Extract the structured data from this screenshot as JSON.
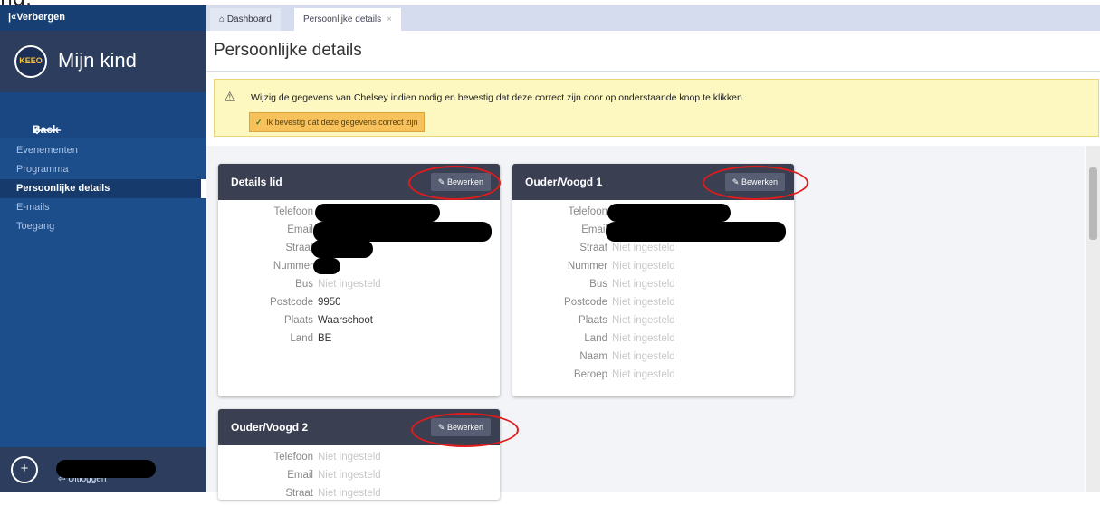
{
  "sidebar": {
    "hide_label": "|«Verbergen",
    "brand_title": "Mijn kind",
    "logo_text": "KEEO",
    "back_label": "Back",
    "nav_items": [
      {
        "label": "Evenementen",
        "active": false
      },
      {
        "label": "Programma",
        "active": false
      },
      {
        "label": "Persoonlijke details",
        "active": true
      },
      {
        "label": "E-mails",
        "active": false
      },
      {
        "label": "Toegang",
        "active": false
      }
    ],
    "logout_label": "Uitloggen"
  },
  "tabs": {
    "dashboard": "Dashboard",
    "personal": "Persoonlijke details"
  },
  "page_title": "Persoonlijke details",
  "warning": {
    "text": "Wijzig de gegevens van Chelsey indien nodig en bevestig dat deze correct zijn door op onderstaande knop te klikken.",
    "confirm_button": "Ik bevestig dat deze gegevens correct zijn"
  },
  "cards": {
    "details": {
      "title": "Details lid",
      "edit_label": "Bewerken",
      "fields": [
        {
          "label": "Telefoon",
          "value": ""
        },
        {
          "label": "Email",
          "value": ""
        },
        {
          "label": "Straat",
          "value": ""
        },
        {
          "label": "Nummer",
          "value": ""
        },
        {
          "label": "Bus",
          "value": "Niet ingesteld"
        },
        {
          "label": "Postcode",
          "value": "9950"
        },
        {
          "label": "Plaats",
          "value": "Waarschoot"
        },
        {
          "label": "Land",
          "value": "BE"
        }
      ]
    },
    "guardian1": {
      "title": "Ouder/Voogd 1",
      "edit_label": "Bewerken",
      "fields": [
        {
          "label": "Telefoon",
          "value": ""
        },
        {
          "label": "Email",
          "value": ""
        },
        {
          "label": "Straat",
          "value": "Niet ingesteld"
        },
        {
          "label": "Nummer",
          "value": "Niet ingesteld"
        },
        {
          "label": "Bus",
          "value": "Niet ingesteld"
        },
        {
          "label": "Postcode",
          "value": "Niet ingesteld"
        },
        {
          "label": "Plaats",
          "value": "Niet ingesteld"
        },
        {
          "label": "Land",
          "value": "Niet ingesteld"
        },
        {
          "label": "Naam",
          "value": "Niet ingesteld"
        },
        {
          "label": "Beroep",
          "value": "Niet ingesteld"
        }
      ]
    },
    "guardian2": {
      "title": "Ouder/Voogd 2",
      "edit_label": "Bewerken",
      "fields": [
        {
          "label": "Telefoon",
          "value": "Niet ingesteld"
        },
        {
          "label": "Email",
          "value": "Niet ingesteld"
        },
        {
          "label": "Straat",
          "value": "Niet ingesteld"
        }
      ]
    }
  },
  "colors": {
    "sidebar": "#1c4e8c",
    "card_header": "#3a3f52",
    "warning_bg": "#fdf7c0",
    "annotation": "#e11b1b"
  }
}
